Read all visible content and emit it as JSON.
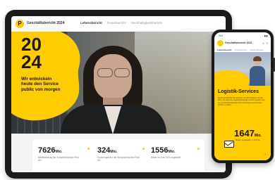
{
  "tablet": {
    "brand": "Geschäftsbericht 2024",
    "nav": [
      "Lebensbericht",
      "Finanzbericht",
      "Nachhaltigkeitsbericht"
    ],
    "hero": {
      "year_top": "20",
      "year_bottom": "24",
      "tagline": "Wir entwickeln heute den Service public von morgen"
    },
    "stats": [
      {
        "value": "7626",
        "unit": "Mio.",
        "desc": "Betriebsertrag der Schweizerischen Post AG"
      },
      {
        "value": "324",
        "unit": "Mio.",
        "desc": "Konzerngewinn der Schweizerischen Post AG"
      },
      {
        "value": "1556",
        "unit": "Mio.",
        "desc": "Briefe im Jahr 2024 zugestellt"
      }
    ]
  },
  "phone": {
    "status_left": "9:41",
    "status_right": "▮▮▮",
    "brand": "Geschäftsbericht 2024",
    "tabs": [
      "Lebensbericht",
      "Finanzbericht",
      "Nachhaltigkeit"
    ],
    "section_title": "Logistik-Services",
    "section_text": "Die Post befördert die Schweiz und die Schweiz mit der Welt. Sie baut ihre Logistiknetzwerke und ihr Angebot aus, um mit den Bedürfnissen ihrer Kundinnen und Kunden Schritt zu halten.",
    "stat_value": "1647",
    "stat_unit": "Mio.",
    "stat_desc": "Briefe zugestellt (+ 0,4 %)",
    "arrow": "→"
  },
  "colors": {
    "accent": "#ffcc00",
    "frame": "#1b1b1b"
  }
}
